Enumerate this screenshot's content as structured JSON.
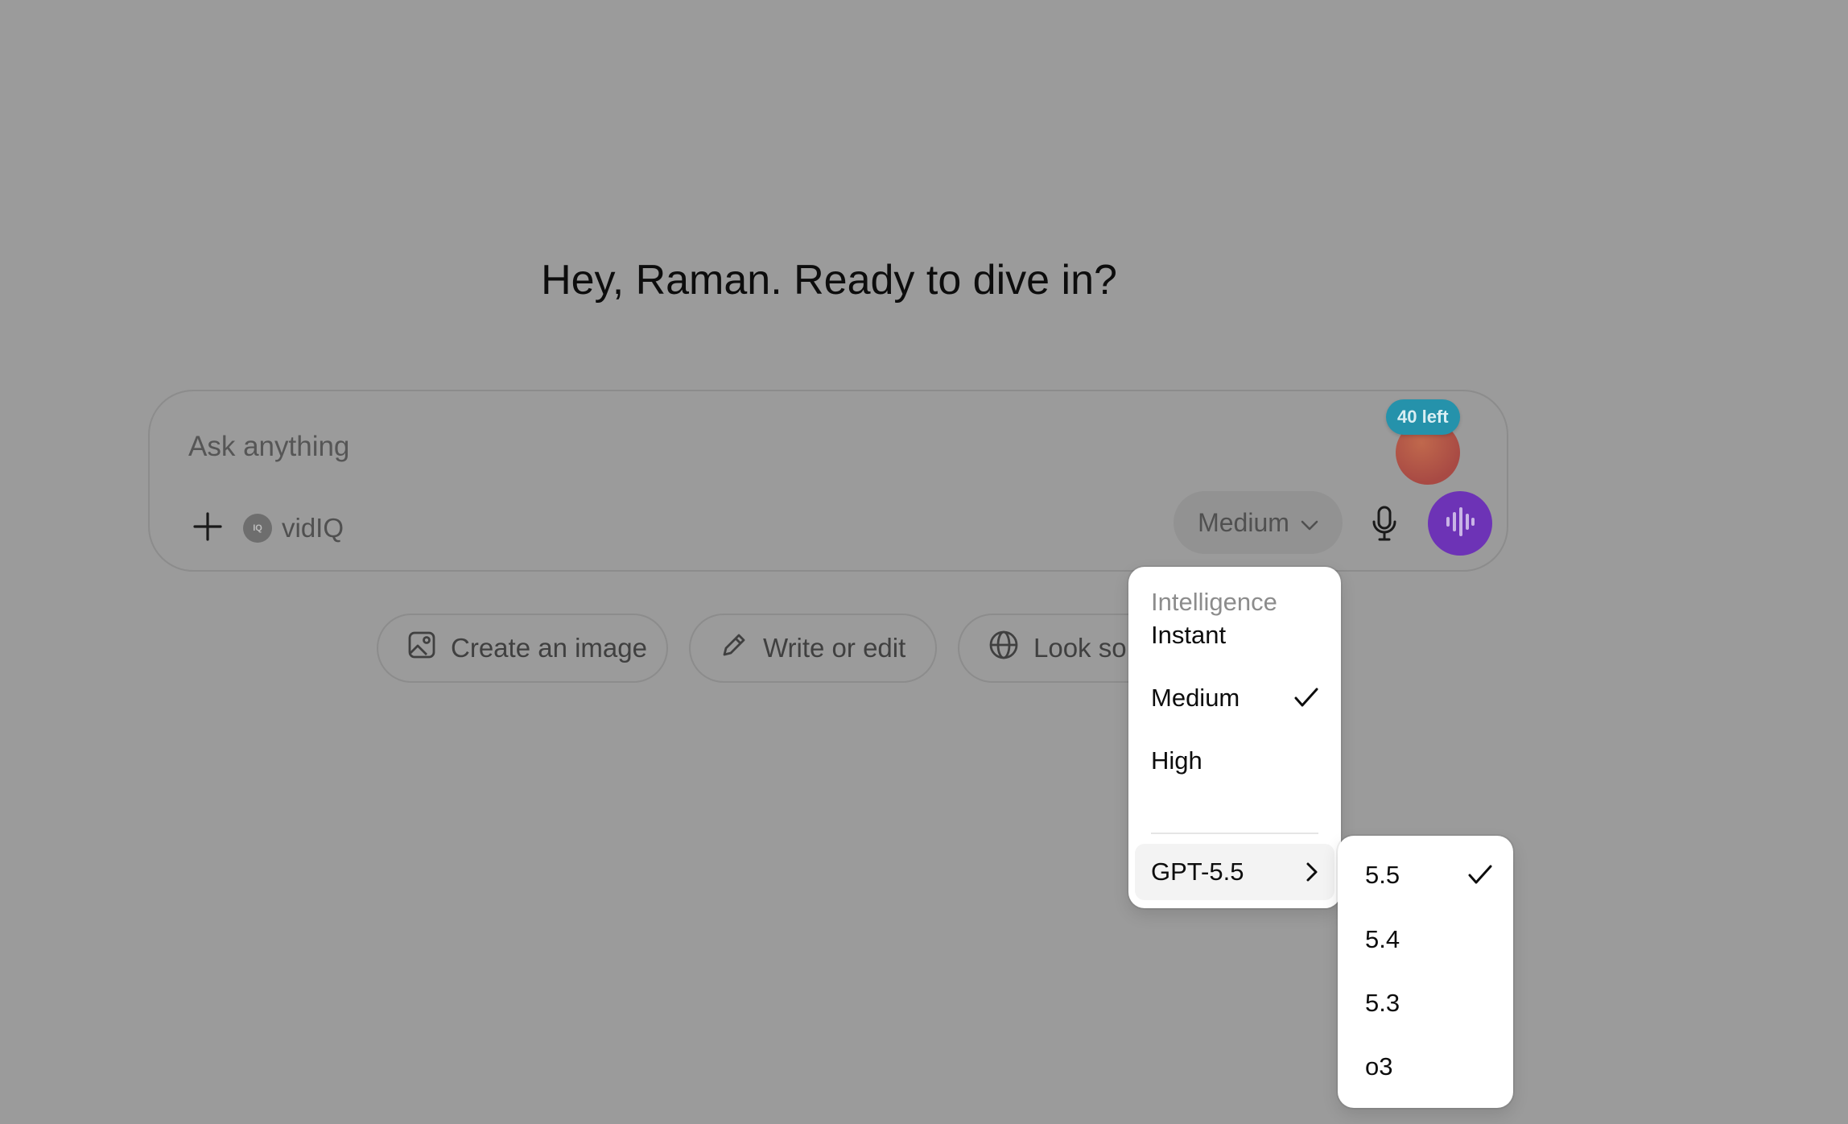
{
  "greeting": "Hey, Raman. Ready to dive in?",
  "composer": {
    "placeholder": "Ask anything",
    "add_icon": "plus-icon",
    "extension": {
      "label": "vidIQ",
      "logo_text": "IQ"
    },
    "model_button": {
      "label": "Medium"
    },
    "badge": "40 left",
    "mic_icon": "microphone-icon",
    "voice_icon": "voice-wave-icon",
    "voice_color": "#6d33b6"
  },
  "chips": [
    {
      "label": "Create an image",
      "icon": "image-icon"
    },
    {
      "label": "Write or edit",
      "icon": "pencil-icon"
    },
    {
      "label": "Look so",
      "icon": "globe-icon"
    }
  ],
  "intelligence_menu": {
    "header": "Intelligence",
    "items": [
      {
        "label": "Instant",
        "selected": false
      },
      {
        "label": "Medium",
        "selected": true
      },
      {
        "label": "High",
        "selected": false
      }
    ],
    "model_item": {
      "label": "GPT-5.5"
    }
  },
  "version_submenu": {
    "items": [
      {
        "label": "5.5",
        "selected": true
      },
      {
        "label": "5.4",
        "selected": false
      },
      {
        "label": "5.3",
        "selected": false
      },
      {
        "label": "o3",
        "selected": false
      }
    ]
  }
}
